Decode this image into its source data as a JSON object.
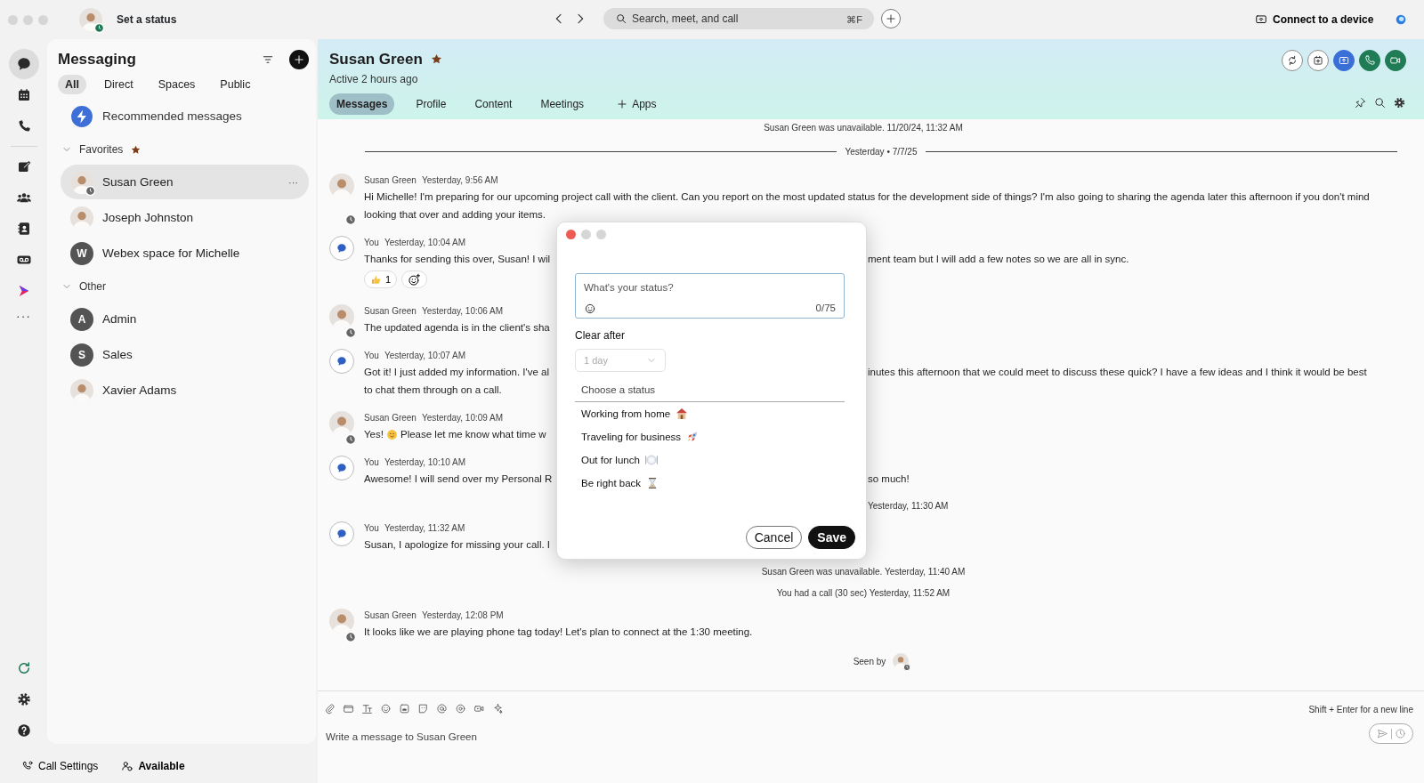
{
  "top_bar": {
    "status_label": "Set a status",
    "search": {
      "placeholder": "Search, meet, and call",
      "shortcut": "⌘F"
    },
    "connect_label": "Connect to a device"
  },
  "rail": {
    "groups": [
      [
        {
          "kind": "chat",
          "selected": true
        },
        {
          "kind": "calendar",
          "selected": false
        },
        {
          "kind": "phone",
          "selected": false
        }
      ],
      [
        {
          "kind": "compose",
          "selected": false
        },
        {
          "kind": "people",
          "selected": false
        },
        {
          "kind": "contacts",
          "selected": false
        },
        {
          "kind": "voicemail",
          "selected": false
        },
        {
          "kind": "apps",
          "selected": false
        }
      ]
    ],
    "more": "···",
    "bottom": [
      {
        "kind": "refresh"
      },
      {
        "kind": "settings"
      },
      {
        "kind": "help"
      }
    ]
  },
  "messaging": {
    "title": "Messaging",
    "filters": [
      {
        "label": "All",
        "selected": true
      },
      {
        "label": "Direct",
        "selected": false
      },
      {
        "label": "Spaces",
        "selected": false
      },
      {
        "label": "Public",
        "selected": false
      }
    ],
    "recommended": "Recommended messages",
    "sections": [
      {
        "title": "Favorites",
        "starred": true,
        "expanded": true,
        "children": [
          {
            "name": "Susan Green",
            "kind": "photo",
            "status_badge": true,
            "selected": true,
            "more": "···"
          },
          {
            "name": "Joseph Johnston",
            "kind": "photo",
            "selected": false
          },
          {
            "name": "Webex space for Michelle",
            "kind": "letter",
            "initial": "W",
            "selected": false
          }
        ]
      },
      {
        "title": "Other",
        "expanded": true,
        "children": [
          {
            "name": "Admin",
            "kind": "letter",
            "initial": "A",
            "selected": false
          },
          {
            "name": "Sales",
            "kind": "letter",
            "initial": "S",
            "selected": false
          },
          {
            "name": "Xavier Adams",
            "kind": "photo",
            "selected": false
          }
        ]
      }
    ]
  },
  "header": {
    "name": "Susan Green",
    "starred": true,
    "presence": "Active 2 hours ago",
    "tabs": [
      {
        "label": "Messages",
        "selected": true
      },
      {
        "label": "Profile",
        "selected": false
      },
      {
        "label": "Content",
        "selected": false
      },
      {
        "label": "Meetings",
        "selected": false
      },
      {
        "label": "Apps",
        "selected": false,
        "kind": "add"
      }
    ],
    "actions": [
      {
        "kind": "sync"
      },
      {
        "kind": "calendar-add"
      },
      {
        "kind": "share"
      },
      {
        "kind": "call"
      },
      {
        "kind": "video"
      }
    ],
    "tools": [
      {
        "kind": "pin"
      },
      {
        "kind": "search"
      },
      {
        "kind": "settings"
      }
    ]
  },
  "chat": {
    "items": [
      {
        "kind": "system",
        "line": [
          {
            "kind": "text",
            "text": "Susan Green was unavailable. 11/20/24, 11:32 AM"
          }
        ]
      },
      {
        "kind": "date",
        "text": "Yesterday • 7/7/25"
      },
      {
        "kind": "message",
        "self": false,
        "sender": "Susan Green",
        "time": "Yesterday, 9:56 AM",
        "text": "Hi Michelle! I'm preparing for our upcoming project call with the client. Can you report on the most updated status for the development side of things? I'm also going to sharing the agenda later this afternoon if you don't mind looking that over and adding your items."
      },
      {
        "kind": "message",
        "self": true,
        "sender": "You",
        "time": "Yesterday, 10:04 AM",
        "lines": [
          [
            {
              "kind": "text",
              "text": "Thanks for sending this over, Susan! I wil"
            },
            {
              "kind": "covered"
            },
            {
              "kind": "text",
              "text": "ment team but I will add a few notes so we are all in sync."
            }
          ]
        ],
        "reactions": [
          {
            "kind": "thumbs",
            "count": "1"
          },
          {
            "kind": "add"
          }
        ]
      },
      {
        "kind": "message",
        "self": false,
        "sender": "Susan Green",
        "time": "Yesterday, 10:06 AM",
        "lines": [
          [
            {
              "kind": "text",
              "text": "The updated agenda is in the client's sha"
            },
            {
              "kind": "covered"
            }
          ]
        ]
      },
      {
        "kind": "message",
        "self": true,
        "sender": "You",
        "time": "Yesterday, 10:07 AM",
        "lines": [
          [
            {
              "kind": "text",
              "text": "Got it! I just added my information. I've al"
            },
            {
              "kind": "covered"
            },
            {
              "kind": "text",
              "text": "inutes this afternoon that we could meet to discuss these quick? I have a few ideas and I think it would be best"
            }
          ],
          [
            {
              "kind": "text",
              "text": "to chat them through on a call."
            }
          ]
        ]
      },
      {
        "kind": "message",
        "self": false,
        "sender": "Susan Green",
        "time": "Yesterday, 10:09 AM",
        "lines": [
          [
            {
              "kind": "text",
              "text": "Yes!"
            },
            {
              "kind": "smile"
            },
            {
              "kind": "text",
              "text": "Please let me know what time w"
            },
            {
              "kind": "covered"
            }
          ]
        ]
      },
      {
        "kind": "message",
        "self": true,
        "sender": "You",
        "time": "Yesterday, 10:10 AM",
        "lines": [
          [
            {
              "kind": "text",
              "text": "Awesome! I will send over my Personal R"
            },
            {
              "kind": "covered"
            },
            {
              "kind": "text",
              "text": "so much!"
            }
          ]
        ]
      },
      {
        "kind": "system",
        "line": [
          {
            "kind": "covered"
          },
          {
            "kind": "text",
            "text": "Yesterday, 11:30 AM"
          }
        ]
      },
      {
        "kind": "message",
        "self": true,
        "sender": "You",
        "time": "Yesterday, 11:32 AM",
        "lines": [
          [
            {
              "kind": "text",
              "text": "Susan, I apologize for missing your call. I"
            },
            {
              "kind": "covered"
            }
          ]
        ]
      },
      {
        "kind": "system",
        "line": [
          {
            "kind": "text",
            "text": "Susan Green was unavailable. Yesterday, 11:40 AM"
          }
        ]
      },
      {
        "kind": "system",
        "line": [
          {
            "kind": "text",
            "text": "You had a call (30 sec) Yesterday, 11:52 AM"
          }
        ]
      },
      {
        "kind": "message",
        "self": false,
        "sender": "Susan Green",
        "time": "Yesterday, 12:08 PM",
        "text": "It looks like we are playing phone tag today! Let's plan to connect at the 1:30 meeting."
      },
      {
        "kind": "seen",
        "text": "Seen by"
      }
    ]
  },
  "composer": {
    "tools": [
      {
        "kind": "attach"
      },
      {
        "kind": "screenshot"
      },
      {
        "kind": "format"
      },
      {
        "kind": "emoji"
      },
      {
        "kind": "gif"
      },
      {
        "kind": "sticker"
      },
      {
        "kind": "mention"
      },
      {
        "kind": "ring"
      },
      {
        "kind": "record"
      },
      {
        "kind": "sparkle"
      }
    ],
    "hint": "Shift + Enter for a new line",
    "placeholder": "Write a message to Susan Green"
  },
  "footer": {
    "call_settings": "Call Settings",
    "availability": "Available"
  },
  "dialog": {
    "field": {
      "placeholder": "What's your status?",
      "counter": "0/75"
    },
    "clear_label": "Clear after",
    "clear_value": "1 day",
    "clear_disabled": true,
    "choose_label": "Choose a status",
    "options": [
      {
        "label": "Working from home",
        "kind": "house"
      },
      {
        "label": "Traveling for business",
        "kind": "rocket"
      },
      {
        "label": "Out for lunch",
        "kind": "plate"
      },
      {
        "label": "Be right back",
        "kind": "hourglass"
      }
    ],
    "buttons": [
      {
        "label": "Cancel",
        "kind": "secondary"
      },
      {
        "label": "Save",
        "kind": "primary"
      }
    ]
  }
}
